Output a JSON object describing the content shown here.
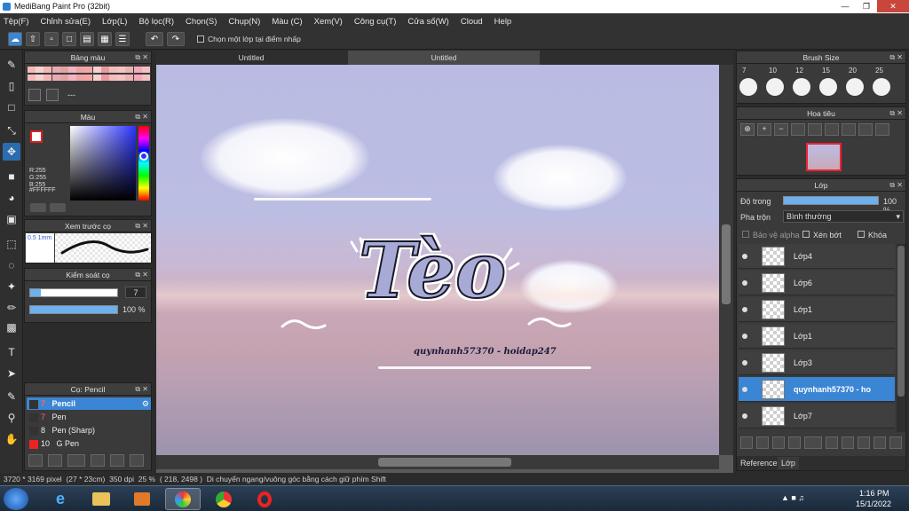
{
  "window": {
    "title": "MediBang Paint Pro (32bit)"
  },
  "menu": [
    "Tệp(F)",
    "Chỉnh sửa(E)",
    "Lớp(L)",
    "Bộ lọc(R)",
    "Chọn(S)",
    "Chụp(N)",
    "Màu (C)",
    "Xem(V)",
    "Công cụ(T)",
    "Cửa sổ(W)",
    "Cloud",
    "Help"
  ],
  "toolbar": {
    "select_layer_label": "Chọn một lớp tại điểm nhấp"
  },
  "tabs": [
    "Untitled",
    "Untitled"
  ],
  "panels": {
    "palette": {
      "title": "Bảng màu",
      "footer": "---"
    },
    "color": {
      "title": "Màu",
      "r": "R:255",
      "g": "G:255",
      "b": "B:255",
      "hex": "#FFFFFF"
    },
    "preview": {
      "title": "Xem trước cọ",
      "size": "0.5 1mm"
    },
    "brush_control": {
      "title": "Kiểm soát cọ",
      "size": "7",
      "opacity": "100 %"
    },
    "brush": {
      "title": "Cọ: Pencil",
      "items": [
        {
          "size": "7",
          "name": "Pencil"
        },
        {
          "size": "7",
          "name": "Pen"
        },
        {
          "size": "8",
          "name": "Pen (Sharp)"
        },
        {
          "size": "10",
          "name": "G Pen"
        }
      ]
    },
    "brush_size": {
      "title": "Brush Size",
      "sizes": [
        "7",
        "10",
        "12",
        "15",
        "20",
        "25"
      ]
    },
    "navigator": {
      "title": "Hoa tiêu"
    },
    "layers": {
      "title": "Lớp",
      "opacity_label": "Độ trong",
      "opacity_value": "100 %",
      "blend_label": "Pha trộn",
      "blend_value": "Bình thường",
      "protect_alpha": "Bảo vệ alpha",
      "clipping": "Xén bớt",
      "lock": "Khóa",
      "items": [
        "Lớp4",
        "Lớp6",
        "Lớp1",
        "Lớp1",
        "Lớp3",
        "quynhanh57370 - ho",
        "Lớp7"
      ]
    },
    "bottom_tabs": [
      "Reference",
      "Lớp"
    ]
  },
  "artwork": {
    "title_text": "Tèo",
    "credit": "quynhanh57370 - hoidap247"
  },
  "status": {
    "dims": "3720 * 3169 pixel",
    "cm": "(27 * 23cm)",
    "dpi": "350 dpi",
    "zoom": "25 %",
    "coords": "( 218, 2498 )",
    "hint": "Di chuyển ngang/vuông góc bằng cách giữ phím Shift"
  },
  "taskbar": {
    "time": "1:16 PM",
    "date": "15/1/2022"
  },
  "colors": {
    "accent": "#3b86d4",
    "panel": "#3a3a3a"
  }
}
